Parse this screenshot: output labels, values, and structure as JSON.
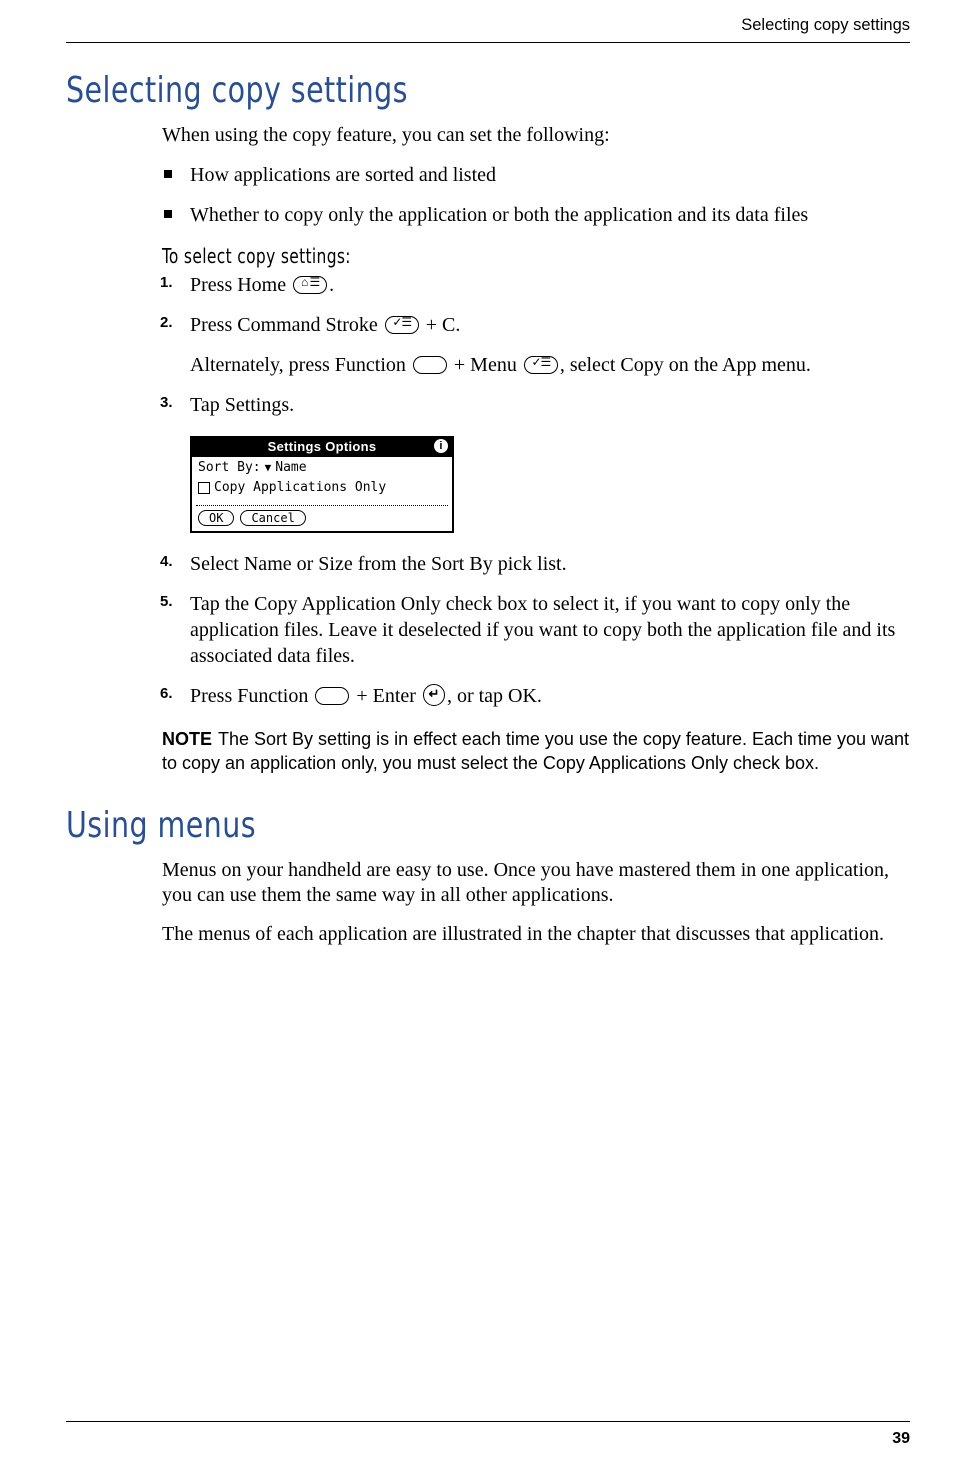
{
  "header": {
    "running": "Selecting copy settings"
  },
  "section1": {
    "title": "Selecting copy settings",
    "intro": "When using the copy feature, you can set the following:",
    "bullets": [
      "How applications are sorted and listed",
      "Whether to copy only the application or both the application and its data files"
    ],
    "procTitle": "To select copy settings:",
    "step1_a": "Press Home ",
    "step1_c": ".",
    "step2_a": "Press Command Stroke ",
    "step2_c": " + C.",
    "step2_sub_a": "Alternately, press Function ",
    "step2_sub_b": " + Menu ",
    "step2_sub_c": ", select Copy on the App menu.",
    "step3": "Tap Settings.",
    "step4": "Select Name or Size from the Sort By pick list.",
    "step5": "Tap the Copy Application Only check box to select it, if you want to copy only the application files. Leave it deselected if you want to copy both the application file and its associated data files.",
    "step6_a": "Press Function ",
    "step6_b": " + Enter ",
    "step6_c": ", or tap OK.",
    "noteLabel": "NOTE",
    "note": "The Sort By setting is in effect each time you use the copy feature. Each time you want to copy an application only, you must select the Copy Applications Only check box."
  },
  "dialog": {
    "title": "Settings Options",
    "sortByLabel": "Sort By:",
    "sortByValue": "Name",
    "checkboxLabel": "Copy Applications Only",
    "ok": "OK",
    "cancel": "Cancel"
  },
  "section2": {
    "title": "Using menus",
    "p1": "Menus on your handheld are easy to use. Once you have mastered them in one application, you can use them the same way in all other applications.",
    "p2": "The menus of each application are illustrated in the chapter that discusses that application."
  },
  "footer": {
    "page": "39"
  }
}
